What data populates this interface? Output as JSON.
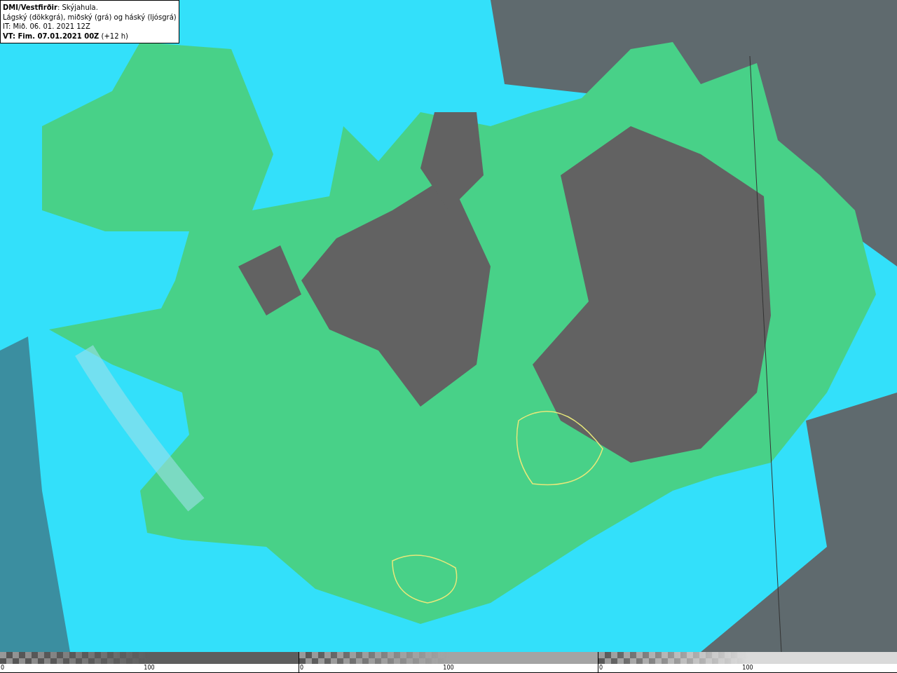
{
  "info_box": {
    "lines": [
      "**DMI/Vestfirðir**: Skýjahula.",
      "Lágský (dökkgrá), miðský (grá) og háský (ljósgrá)",
      "IT: Mið. 06. 01. 2021 12Z",
      "**VT: Fim. 07.01.2021 00Z** (+12 h)"
    ]
  },
  "legends": [
    {
      "color": "#5e5e5e",
      "min_label": "0",
      "max_label": "100"
    },
    {
      "color": "#a4a4a4",
      "min_label": "0",
      "max_label": "100"
    },
    {
      "color": "#dadada",
      "min_label": "0",
      "max_label": "100"
    }
  ]
}
